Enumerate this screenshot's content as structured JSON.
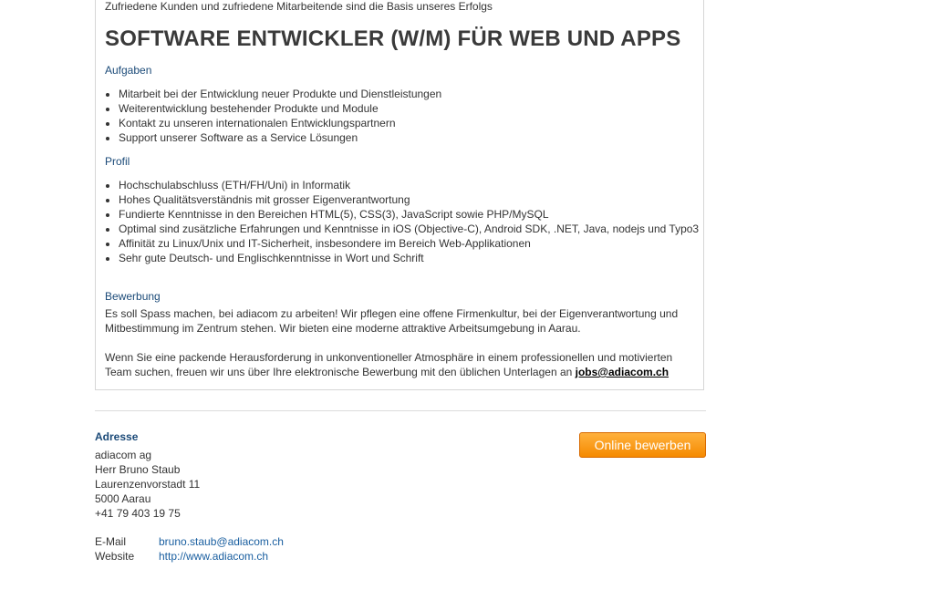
{
  "job": {
    "tagline": "Zufriedene Kunden und zufriedene Mitarbeitende sind die Basis unseres Erfolgs",
    "title": "SOFTWARE ENTWICKLER (W/M) FÜR WEB UND APPS",
    "sections": {
      "tasks": {
        "heading": "Aufgaben",
        "items": [
          "Mitarbeit bei der Entwicklung neuer Produkte und Dienstleistungen",
          "Weiterentwicklung bestehender Produkte und Module",
          "Kontakt zu unseren internationalen Entwicklungspartnern",
          "Support unserer Software as a Service Lösungen"
        ]
      },
      "profile": {
        "heading": "Profil",
        "items": [
          "Hochschulabschluss (ETH/FH/Uni) in Informatik",
          "Hohes Qualitätsverständnis mit grosser Eigenverantwortung",
          "Fundierte Kenntnisse in den Bereichen HTML(5), CSS(3), JavaScript sowie PHP/MySQL",
          "Optimal sind zusätzliche Erfahrungen und Kenntnisse in iOS (Objective-C), Android SDK, .NET, Java, nodejs und Typo3",
          "Affinität zu Linux/Unix und IT-Sicherheit, insbesondere im Bereich Web-Applikationen",
          "Sehr gute Deutsch- und Englischkenntnisse in Wort und Schrift"
        ]
      },
      "application": {
        "heading": "Bewerbung",
        "paragraph1": "Es soll Spass machen, bei adiacom zu arbeiten! Wir pflegen eine offene Firmenkultur, bei der Eigenverantwortung und Mitbestimmung im Zentrum stehen. Wir bieten eine moderne attraktive Arbeitsumgebung in Aarau.",
        "paragraph2": "Wenn Sie eine packende Herausforderung in unkonventioneller Atmosphäre in einem professionellen und motivierten Team suchen, freuen wir uns über Ihre elektronische Bewerbung mit den üblichen Unterlagen an",
        "email": "jobs@adiacom.ch"
      }
    }
  },
  "address": {
    "heading": "Adresse",
    "lines": [
      "adiacom ag",
      "Herr Bruno Staub",
      "Laurenzenvorstadt 11",
      "5000 Aarau",
      "+41 79 403 19 75"
    ],
    "email_label": "E-Mail",
    "email": "bruno.staub@adiacom.ch",
    "website_label": "Website",
    "website": "http://www.adiacom.ch"
  },
  "apply_button": "Online bewerben",
  "colors": {
    "heading_blue": "#1b4a78",
    "link_blue": "#1a5fa0",
    "button_orange": "#f58a00"
  }
}
